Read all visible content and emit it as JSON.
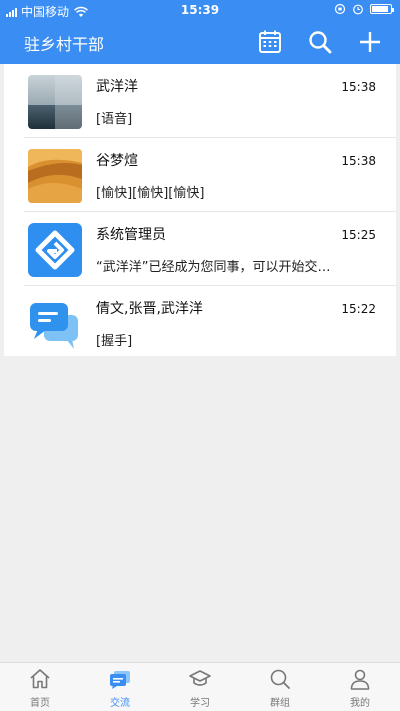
{
  "status": {
    "carrier": "中国移动",
    "time": "15:39",
    "battery_level": 0.9
  },
  "nav": {
    "title": "驻乡村干部"
  },
  "conversations": [
    {
      "name": "武洋洋",
      "time": "15:38",
      "message": "[语音]",
      "avatar": "landscape-photo"
    },
    {
      "name": "谷梦煊",
      "time": "15:38",
      "message": "[愉快][愉快][愉快]",
      "avatar": "desert-photo"
    },
    {
      "name": "系统管理员",
      "time": "15:25",
      "message": "“武洋洋”已经成为您同事，可以开始交…",
      "avatar": "g-logo-icon"
    },
    {
      "name": "倩文,张晋,武洋洋",
      "time": "15:22",
      "message": "[握手]",
      "avatar": "group-chat-icon"
    }
  ],
  "tabs": [
    {
      "label": "首页",
      "icon": "home-icon"
    },
    {
      "label": "交流",
      "icon": "chat-icon"
    },
    {
      "label": "学习",
      "icon": "mortarboard-icon"
    },
    {
      "label": "群组",
      "icon": "search-icon"
    },
    {
      "label": "我的",
      "icon": "person-icon"
    }
  ],
  "colors": {
    "primary": "#3a8df3",
    "tab_inactive": "#777777"
  }
}
